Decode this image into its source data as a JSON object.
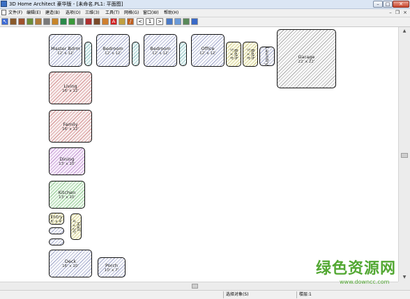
{
  "window": {
    "title": "3D Home Architect 豪华版 - [未命名.PL1: 平面图]",
    "controls": {
      "minimize": "–",
      "maximize": "□",
      "close": "✕"
    }
  },
  "menu": {
    "items": [
      "文件(F)",
      "编辑(E)",
      "建造(B)",
      "选项(O)",
      "三维(3)",
      "工具(T)",
      "网格(G)",
      "窗口(W)",
      "帮助(H)"
    ],
    "mdi": {
      "minimize": "–",
      "restore": "❐",
      "close": "×"
    }
  },
  "toolbar": {
    "tools": [
      {
        "icon": "select-arrow-icon",
        "glyph": "↖",
        "color": "#3d6bd6"
      },
      {
        "icon": "door-icon",
        "glyph": "",
        "color": "#8a5a2b"
      },
      {
        "icon": "wall-icon",
        "glyph": "",
        "color": "#a0522d"
      },
      {
        "icon": "window-icon",
        "glyph": "",
        "color": "#6b8e3a"
      },
      {
        "icon": "cabinet-icon",
        "glyph": "",
        "color": "#b07a3a"
      },
      {
        "icon": "stairs-icon",
        "glyph": "",
        "color": "#7a7a7a"
      },
      {
        "icon": "furniture-icon",
        "glyph": "",
        "color": "#c8862a"
      },
      {
        "icon": "electrical-icon",
        "glyph": "",
        "color": "#2a8a4a"
      },
      {
        "icon": "plant-icon",
        "glyph": "",
        "color": "#3a9a3a"
      },
      {
        "icon": "fixture-icon",
        "glyph": "",
        "color": "#7a7a7a"
      },
      {
        "icon": "roof-icon",
        "glyph": "",
        "color": "#b03030"
      },
      {
        "icon": "camera-icon",
        "glyph": "",
        "color": "#7a4a2a"
      },
      {
        "icon": "paint-bucket-icon",
        "glyph": "",
        "color": "#d08030"
      },
      {
        "icon": "text-icon",
        "glyph": "A",
        "color": "#d02020"
      },
      {
        "icon": "dimension-icon",
        "glyph": "",
        "color": "#c0a040"
      },
      {
        "icon": "pencil-icon",
        "glyph": "/",
        "color": "#c06020"
      }
    ],
    "floor_prev": "<",
    "floor_number": "1",
    "floor_next": ">",
    "view_tools": [
      {
        "icon": "grid-icon",
        "glyph": "",
        "color": "#4a7ac8"
      },
      {
        "icon": "3d-view-icon",
        "glyph": "",
        "color": "#6a9ad8"
      },
      {
        "icon": "render-icon",
        "glyph": "",
        "color": "#5a8a5a"
      },
      {
        "icon": "zoom-icon",
        "glyph": "",
        "color": "#3a6ac8"
      }
    ]
  },
  "rooms": [
    {
      "id": "master-bedroom",
      "label": "Master Bdrm",
      "dims": "12' x 12'",
      "hatch": "hb"
    },
    {
      "id": "closet-1",
      "label": "",
      "dims": "",
      "hatch": "hc"
    },
    {
      "id": "bedroom-1",
      "label": "Bedroom",
      "dims": "12' x 12'",
      "hatch": "hb"
    },
    {
      "id": "closet-2",
      "label": "",
      "dims": "",
      "hatch": "hc"
    },
    {
      "id": "bedroom-2",
      "label": "Bedroom",
      "dims": "12' x 12'",
      "hatch": "hb"
    },
    {
      "id": "closet-3",
      "label": "",
      "dims": "",
      "hatch": "hc"
    },
    {
      "id": "office",
      "label": "Office",
      "dims": "12' x 12'",
      "hatch": "hb"
    },
    {
      "id": "bath-1",
      "label": "Bath",
      "dims": "5' x 8'",
      "hatch": "hy"
    },
    {
      "id": "bath-2",
      "label": "Bath",
      "dims": "5' x 8'",
      "hatch": "hy"
    },
    {
      "id": "laundry",
      "label": "Laundry",
      "dims": "",
      "hatch": "hb"
    },
    {
      "id": "garage",
      "label": "Garage",
      "dims": "22' x 22'",
      "hatch": "hgr"
    },
    {
      "id": "living",
      "label": "Living",
      "dims": "16' x 12'",
      "hatch": "hr"
    },
    {
      "id": "family",
      "label": "Family",
      "dims": "16' x 12'",
      "hatch": "hr"
    },
    {
      "id": "dining",
      "label": "Dining",
      "dims": "13' x 10'",
      "hatch": "hp"
    },
    {
      "id": "kitchen",
      "label": "Kitchen",
      "dims": "13' x 10'",
      "hatch": "hg"
    },
    {
      "id": "entry",
      "label": "Entry",
      "dims": "6' x 4'",
      "hatch": "hy"
    },
    {
      "id": "closet-4",
      "label": "",
      "dims": "",
      "hatch": "hb"
    },
    {
      "id": "closet-5",
      "label": "",
      "dims": "",
      "hatch": "hb"
    },
    {
      "id": "hall",
      "label": "Hall",
      "dims": "4' x 20'",
      "hatch": "hy"
    },
    {
      "id": "deck",
      "label": "Deck",
      "dims": "16' x 10'",
      "hatch": "hb"
    },
    {
      "id": "porch",
      "label": "Porch",
      "dims": "10' x 7'",
      "hatch": "hb"
    }
  ],
  "scrollbar": {
    "up": "▲",
    "down": "▼"
  },
  "status": {
    "prompt": "选择对象(S)",
    "floor": "楼层:1"
  },
  "watermark": {
    "brand": "绿色资源网",
    "url": "www.downcc.com"
  }
}
